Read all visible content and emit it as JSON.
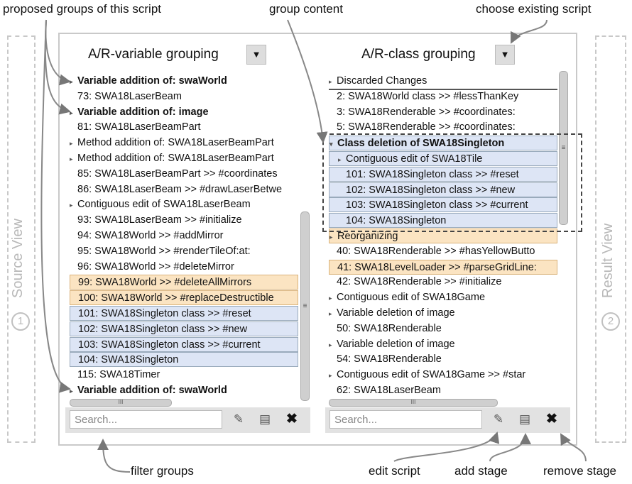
{
  "annotations": {
    "proposed_groups": "proposed groups of this script",
    "group_content": "group content",
    "choose_script": "choose existing script",
    "filter_groups": "filter groups",
    "edit_script": "edit script",
    "add_stage": "add stage",
    "remove_stage": "remove stage"
  },
  "side_views": {
    "left": {
      "number": "1",
      "label": "Source View"
    },
    "right": {
      "number": "2",
      "label": "Result View"
    }
  },
  "left_panel": {
    "title": "A/R-variable grouping",
    "dropdown": "▼",
    "rows": [
      {
        "text": "Variable addition of:  swaWorld",
        "arrow": "▸",
        "style": "bold"
      },
      {
        "text": "73: SWA18LaserBeam",
        "arrow": "",
        "style": "plain"
      },
      {
        "text": "Variable addition of:  image",
        "arrow": "▸",
        "style": "bold"
      },
      {
        "text": "81: SWA18LaserBeamPart",
        "arrow": "",
        "style": "plain"
      },
      {
        "text": "Method addition of:  SWA18LaserBeamPart",
        "arrow": "▸",
        "style": "plain"
      },
      {
        "text": "Method addition of:  SWA18LaserBeamPart",
        "arrow": "▸",
        "style": "plain"
      },
      {
        "text": "85: SWA18LaserBeamPart >> #coordinates",
        "arrow": "",
        "style": "plain"
      },
      {
        "text": "86: SWA18LaserBeam >> #drawLaserBetwe",
        "arrow": "",
        "style": "plain"
      },
      {
        "text": "Contiguous edit of   SWA18LaserBeam",
        "arrow": "▸",
        "style": "plain"
      },
      {
        "text": "93: SWA18LaserBeam >> #initialize",
        "arrow": "",
        "style": "plain"
      },
      {
        "text": "94: SWA18World >> #addMirror",
        "arrow": "",
        "style": "plain"
      },
      {
        "text": "95: SWA18World >> #renderTileOf:at:",
        "arrow": "",
        "style": "plain"
      },
      {
        "text": "96: SWA18World >> #deleteMirror",
        "arrow": "",
        "style": "plain"
      },
      {
        "text": "99: SWA18World >> #deleteAllMirrors",
        "arrow": "",
        "style": "orange"
      },
      {
        "text": "100: SWA18World >> #replaceDestructible",
        "arrow": "",
        "style": "orange"
      },
      {
        "text": "101: SWA18Singleton class >> #reset",
        "arrow": "",
        "style": "blue"
      },
      {
        "text": "102: SWA18Singleton class >> #new",
        "arrow": "",
        "style": "blue"
      },
      {
        "text": "103: SWA18Singleton class >> #current",
        "arrow": "",
        "style": "blue"
      },
      {
        "text": "104: SWA18Singleton",
        "arrow": "",
        "style": "blue"
      },
      {
        "text": "115: SWA18Timer",
        "arrow": "",
        "style": "plain"
      },
      {
        "text": "Variable addition of:  swaWorld",
        "arrow": "▸",
        "style": "bold"
      }
    ],
    "search_placeholder": "Search..."
  },
  "right_panel": {
    "title": "A/R-class grouping",
    "dropdown": "▼",
    "rows": [
      {
        "text": "Discarded Changes",
        "arrow": "▸",
        "style": "header"
      },
      {
        "text": "2: SWA18World class >> #lessThanKey",
        "arrow": "",
        "style": "plain"
      },
      {
        "text": "3: SWA18Renderable >> #coordinates:",
        "arrow": "",
        "style": "plain"
      },
      {
        "text": "5: SWA18Renderable >> #coordinates:",
        "arrow": "",
        "style": "plain"
      },
      {
        "text": "Class deletion of SWA18Singleton",
        "arrow": "▾",
        "style": "blue-bold"
      },
      {
        "text": "Contiguous edit of   SWA18Tile",
        "arrow": "▸",
        "style": "blue-indent"
      },
      {
        "text": "101: SWA18Singleton class >> #reset",
        "arrow": "",
        "style": "blue-indent"
      },
      {
        "text": "102: SWA18Singleton class >> #new",
        "arrow": "",
        "style": "blue-indent"
      },
      {
        "text": "103: SWA18Singleton class >> #current",
        "arrow": "",
        "style": "blue-indent"
      },
      {
        "text": "104: SWA18Singleton",
        "arrow": "",
        "style": "blue-indent"
      },
      {
        "text": "Reorganizing",
        "arrow": "▸",
        "style": "orange"
      },
      {
        "text": "40: SWA18Renderable >> #hasYellowButto",
        "arrow": "",
        "style": "plain"
      },
      {
        "text": "41: SWA18LevelLoader >> #parseGridLine:",
        "arrow": "",
        "style": "orange"
      },
      {
        "text": "42: SWA18Renderable >> #initialize",
        "arrow": "",
        "style": "plain"
      },
      {
        "text": "Contiguous edit of   SWA18Game",
        "arrow": "▸",
        "style": "plain"
      },
      {
        "text": "Variable deletion of  image",
        "arrow": "▸",
        "style": "plain"
      },
      {
        "text": "50: SWA18Renderable",
        "arrow": "",
        "style": "plain"
      },
      {
        "text": "Variable deletion of  image",
        "arrow": "▸",
        "style": "plain"
      },
      {
        "text": "54: SWA18Renderable",
        "arrow": "",
        "style": "plain"
      },
      {
        "text": "Contiguous edit of   SWA18Game >> #star",
        "arrow": "▸",
        "style": "plain"
      },
      {
        "text": "62: SWA18LaserBeam",
        "arrow": "",
        "style": "plain"
      }
    ],
    "search_placeholder": "Search..."
  },
  "toolbar_icons": {
    "edit": "✎",
    "add": "▤",
    "remove": "✖"
  },
  "scroll_grip": "≡",
  "hscroll_grip": "III"
}
